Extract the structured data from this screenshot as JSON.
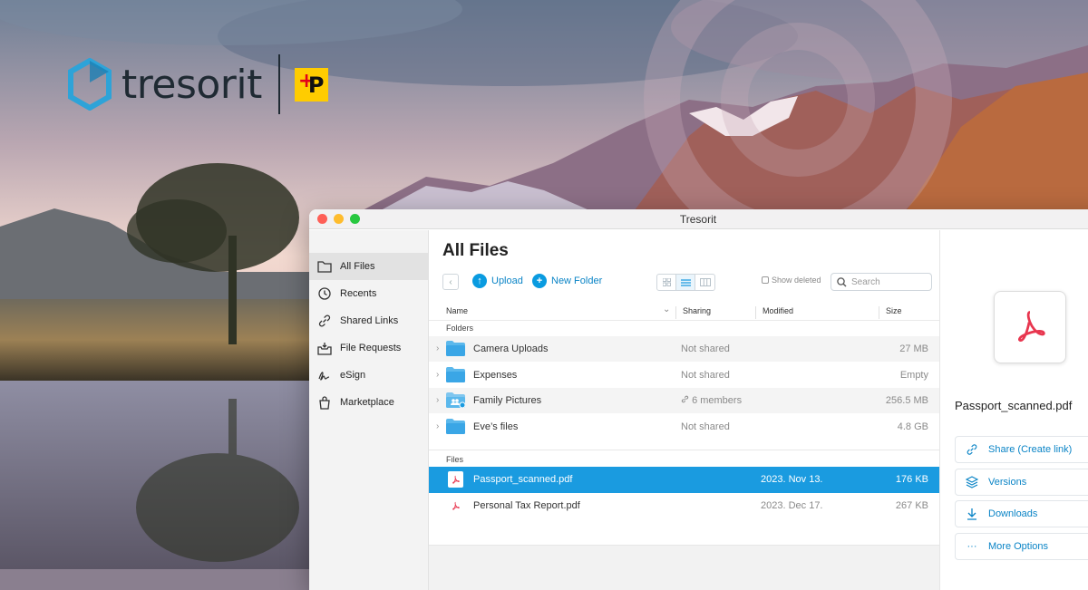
{
  "brand": {
    "name": "tresorit",
    "partner_logo_text": "P",
    "accent": "#2ea3d8"
  },
  "window": {
    "title": "Tresorit"
  },
  "sidebar": {
    "items": [
      {
        "label": "All Files",
        "icon": "folder-icon",
        "active": true
      },
      {
        "label": "Recents",
        "icon": "clock-icon"
      },
      {
        "label": "Shared Links",
        "icon": "link-icon"
      },
      {
        "label": "File Requests",
        "icon": "file-request-icon"
      },
      {
        "label": "eSign",
        "icon": "signature-icon"
      },
      {
        "label": "Marketplace",
        "icon": "shopping-bag-icon"
      }
    ]
  },
  "main": {
    "title": "All Files",
    "toolbar": {
      "upload_label": "Upload",
      "new_folder_label": "New Folder",
      "show_deleted_label": "Show deleted",
      "search_placeholder": "Search"
    },
    "columns": {
      "name": "Name",
      "sharing": "Sharing",
      "modified": "Modified",
      "size": "Size"
    },
    "folders_label": "Folders",
    "files_label": "Files",
    "folders": [
      {
        "name": "Camera Uploads",
        "sharing": "Not shared",
        "modified": "",
        "size": "27 MB"
      },
      {
        "name": "Expenses",
        "sharing": "Not shared",
        "modified": "",
        "size": "Empty"
      },
      {
        "name": "Family Pictures",
        "sharing": "6 members",
        "modified": "",
        "size": "256.5 MB",
        "shared": true
      },
      {
        "name": "Eve’s files",
        "sharing": "Not shared",
        "modified": "",
        "size": "4.8 GB"
      }
    ],
    "files": [
      {
        "name": "Passport_scanned.pdf",
        "sharing": "",
        "modified": "2023. Nov 13.",
        "size": "176 KB",
        "selected": true
      },
      {
        "name": "Personal Tax Report.pdf",
        "sharing": "",
        "modified": "2023. Dec 17.",
        "size": "267 KB"
      }
    ]
  },
  "details": {
    "file_name": "Passport_scanned.pdf",
    "actions": [
      {
        "label": "Share (Create link)",
        "icon": "link-icon"
      },
      {
        "label": "Versions",
        "icon": "layers-icon"
      },
      {
        "label": "Downloads",
        "icon": "download-icon"
      },
      {
        "label": "More Options",
        "icon": "more-icon"
      }
    ]
  },
  "colors": {
    "selection": "#1a9be0",
    "link": "#0a84c6",
    "pdf_red": "#e8364f"
  }
}
